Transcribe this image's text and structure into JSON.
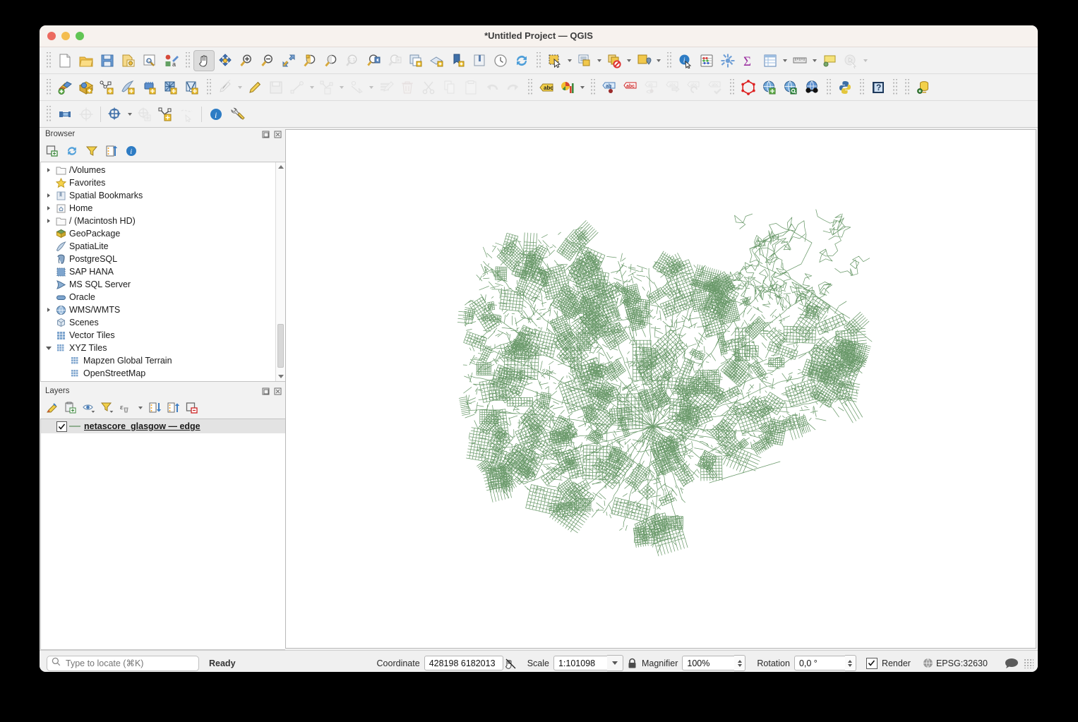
{
  "window": {
    "title": "*Untitled Project — QGIS",
    "traffic_lights": [
      "close",
      "minimize",
      "zoom"
    ]
  },
  "toolbars": {
    "row1": [
      {
        "name": "new-project-icon",
        "label": "New Project"
      },
      {
        "name": "open-project-icon",
        "label": "Open Project"
      },
      {
        "name": "save-project-icon",
        "label": "Save Project"
      },
      {
        "name": "new-print-layout-icon",
        "label": "New Print Layout"
      },
      {
        "name": "style-manager-icon",
        "label": "Style Manager"
      },
      {
        "name": "show-layout-manager-icon",
        "label": "Layout Manager"
      },
      {
        "name": "pan-map-icon",
        "label": "Pan Map",
        "selected": true
      },
      {
        "name": "pan-to-selection-icon",
        "label": "Pan Map to Selection"
      },
      {
        "name": "zoom-in-icon",
        "label": "Zoom In"
      },
      {
        "name": "zoom-out-icon",
        "label": "Zoom Out"
      },
      {
        "name": "zoom-full-icon",
        "label": "Zoom Full"
      },
      {
        "name": "zoom-selection-icon",
        "label": "Zoom to Selection"
      },
      {
        "name": "zoom-layer-icon",
        "label": "Zoom to Layer"
      },
      {
        "name": "zoom-native-icon",
        "label": "Zoom to Native Resolution"
      },
      {
        "name": "zoom-last-icon",
        "label": "Zoom Last"
      },
      {
        "name": "zoom-next-icon",
        "label": "Zoom Next"
      },
      {
        "name": "new-map-view-icon",
        "label": "New Map View"
      },
      {
        "name": "new-3d-map-view-icon",
        "label": "New 3D Map View"
      },
      {
        "name": "new-print-layout2-icon",
        "label": "New Print Layout"
      },
      {
        "name": "new-report-icon",
        "label": "New Report"
      },
      {
        "name": "temporal-controller-icon",
        "label": "Temporal Controller"
      },
      {
        "name": "refresh-icon",
        "label": "Refresh"
      },
      {
        "name": "select-features-icon",
        "label": "Select Features"
      },
      {
        "name": "select-value-icon",
        "label": "Select Features by Value"
      },
      {
        "name": "deselect-features-icon",
        "label": "Deselect Features"
      },
      {
        "name": "select-location-icon",
        "label": "Select by Location"
      },
      {
        "name": "identify-features-icon",
        "label": "Identify Features"
      },
      {
        "name": "statistical-summary-icon",
        "label": "Statistical Summary"
      },
      {
        "name": "processing-toolbox-icon",
        "label": "Processing Toolbox"
      },
      {
        "name": "field-calculator-icon",
        "label": "Field Calculator"
      },
      {
        "name": "attribute-table-icon",
        "label": "Open Attribute Table"
      },
      {
        "name": "measure-line-icon",
        "label": "Measure Line"
      },
      {
        "name": "map-tips-icon",
        "label": "Show Map Tips"
      },
      {
        "name": "run-model-icon",
        "label": "Run Model"
      }
    ],
    "row2": [
      {
        "name": "add-vector-layer-icon",
        "label": "Add Vector Layer"
      },
      {
        "name": "add-raster-layer-icon",
        "label": "Add Raster Layer"
      },
      {
        "name": "add-delimited-text-layer-icon",
        "label": "Add Delimited Text Layer"
      },
      {
        "name": "add-spatialite-layer-icon",
        "label": "Add SpatiaLite Layer"
      },
      {
        "name": "add-mesh-layer-icon",
        "label": "Add Mesh Layer"
      },
      {
        "name": "add-wms-layer-icon",
        "label": "Add WMS/WMTS Layer"
      },
      {
        "name": "add-vector-tile-layer-icon",
        "label": "Add Vector Tile Layer"
      },
      {
        "name": "current-edits-icon",
        "label": "Current Edits"
      },
      {
        "name": "toggle-editing-icon",
        "label": "Toggle Editing"
      },
      {
        "name": "save-layer-edits-icon",
        "label": "Save Layer Edits"
      },
      {
        "name": "add-line-feature-icon",
        "label": "Add Line Feature"
      },
      {
        "name": "vertex-tool-icon",
        "label": "Vertex Tool"
      },
      {
        "name": "modify-attributes-icon",
        "label": "Modify Attributes of Features"
      },
      {
        "name": "multi-edit-icon",
        "label": "Multi-Edit"
      },
      {
        "name": "delete-selected-icon",
        "label": "Delete Selected"
      },
      {
        "name": "cut-features-icon",
        "label": "Cut Features"
      },
      {
        "name": "copy-features-icon",
        "label": "Copy Features"
      },
      {
        "name": "paste-features-icon",
        "label": "Paste Features"
      },
      {
        "name": "undo-icon",
        "label": "Undo"
      },
      {
        "name": "redo-icon",
        "label": "Redo"
      },
      {
        "name": "label-icon",
        "label": "Layer Labeling Options"
      },
      {
        "name": "diagram-icon",
        "label": "Layer Diagram Options"
      },
      {
        "name": "highlight-pinned-labels-icon",
        "label": "Highlight Pinned Labels"
      },
      {
        "name": "pin-labels-icon",
        "label": "Pin/Unpin Labels"
      },
      {
        "name": "show-hide-labels-icon",
        "label": "Show/Hide Labels"
      },
      {
        "name": "move-label-icon",
        "label": "Move Label"
      },
      {
        "name": "rotate-label-icon",
        "label": "Rotate Label"
      },
      {
        "name": "change-label-icon",
        "label": "Change Label"
      },
      {
        "name": "georeferencer-icon",
        "label": "Georeferencer"
      },
      {
        "name": "metasearch-add-icon",
        "label": "MetaSearch"
      },
      {
        "name": "metasearch-find-icon",
        "label": "MetaSearch Catalogue"
      },
      {
        "name": "quickosm-icon",
        "label": "QuickOSM"
      },
      {
        "name": "python-console-icon",
        "label": "Python Console"
      },
      {
        "name": "help-icon",
        "label": "Help"
      },
      {
        "name": "db-manager-icon",
        "label": "DB Manager"
      }
    ],
    "row3": [
      {
        "name": "snapping-toolbar-icon",
        "label": "Snapping Options"
      },
      {
        "name": "enable-snapping-icon",
        "label": "Enable Snapping"
      },
      {
        "name": "snap-to-grid-icon",
        "label": "Snapping on Intersection"
      },
      {
        "name": "snap-add-icon",
        "label": "Add Snapping Mode"
      },
      {
        "name": "topological-editing-icon",
        "label": "Topological Editing"
      },
      {
        "name": "avoid-overlap-icon",
        "label": "Avoid Overlap"
      },
      {
        "name": "snapping-info-icon",
        "label": "Snapping Info"
      },
      {
        "name": "snapping-settings-icon",
        "label": "Snapping Settings"
      }
    ]
  },
  "browser": {
    "title": "Browser",
    "panel_buttons": [
      "float-panel-icon",
      "close-panel-icon"
    ],
    "toolbar": [
      {
        "name": "add-layer-icon",
        "label": "Add Selected Layers"
      },
      {
        "name": "refresh-icon",
        "label": "Refresh"
      },
      {
        "name": "filter-browser-icon",
        "label": "Filter Browser"
      },
      {
        "name": "collapse-all-icon",
        "label": "Collapse All"
      },
      {
        "name": "browser-properties-icon",
        "label": "Properties"
      }
    ],
    "items": [
      {
        "label": "/Volumes",
        "icon": "folder-icon",
        "expandable": true,
        "expanded": false,
        "indent": 0
      },
      {
        "label": "Favorites",
        "icon": "star-icon",
        "expandable": false,
        "indent": 0
      },
      {
        "label": "Spatial Bookmarks",
        "icon": "bookmark-icon",
        "expandable": true,
        "expanded": false,
        "indent": 0
      },
      {
        "label": "Home",
        "icon": "home-icon",
        "expandable": true,
        "expanded": false,
        "indent": 0
      },
      {
        "label": "/ (Macintosh HD)",
        "icon": "folder-icon",
        "expandable": true,
        "expanded": false,
        "indent": 0
      },
      {
        "label": "GeoPackage",
        "icon": "geopackage-icon",
        "expandable": false,
        "indent": 0
      },
      {
        "label": "SpatiaLite",
        "icon": "spatialite-icon",
        "expandable": false,
        "indent": 0
      },
      {
        "label": "PostgreSQL",
        "icon": "postgresql-icon",
        "expandable": false,
        "indent": 0
      },
      {
        "label": "SAP HANA",
        "icon": "saphana-icon",
        "expandable": false,
        "indent": 0
      },
      {
        "label": "MS SQL Server",
        "icon": "mssql-icon",
        "expandable": false,
        "indent": 0
      },
      {
        "label": "Oracle",
        "icon": "oracle-icon",
        "expandable": false,
        "indent": 0
      },
      {
        "label": "WMS/WMTS",
        "icon": "wms-icon",
        "expandable": true,
        "expanded": false,
        "indent": 0
      },
      {
        "label": "Scenes",
        "icon": "scenes-icon",
        "expandable": false,
        "indent": 0
      },
      {
        "label": "Vector Tiles",
        "icon": "vector-tiles-icon",
        "expandable": false,
        "indent": 0
      },
      {
        "label": "XYZ Tiles",
        "icon": "xyz-tiles-icon",
        "expandable": true,
        "expanded": true,
        "indent": 0
      },
      {
        "label": "Mapzen Global Terrain",
        "icon": "xyz-tiles-icon",
        "expandable": false,
        "indent": 1
      },
      {
        "label": "OpenStreetMap",
        "icon": "xyz-tiles-icon",
        "expandable": false,
        "indent": 1
      }
    ]
  },
  "layers": {
    "title": "Layers",
    "panel_buttons": [
      "float-panel-icon",
      "close-panel-icon"
    ],
    "toolbar": [
      {
        "name": "open-layer-styling-icon",
        "label": "Open the Layer Styling panel"
      },
      {
        "name": "add-group-icon",
        "label": "Add Group"
      },
      {
        "name": "manage-visibility-icon",
        "label": "Manage Map Themes"
      },
      {
        "name": "filter-legend-icon",
        "label": "Filter Legend"
      },
      {
        "name": "filter-expression-icon",
        "label": "Filter Legend by Expression"
      },
      {
        "name": "expand-all-icon",
        "label": "Expand All"
      },
      {
        "name": "collapse-all-icon",
        "label": "Collapse All"
      },
      {
        "name": "remove-layer-icon",
        "label": "Remove Layer/Group"
      }
    ],
    "items": [
      {
        "name": "netascore_glasgow — edge",
        "checked": true,
        "symbol_color": "#8fae8f",
        "selected": true
      }
    ]
  },
  "map": {
    "layer_color": "#6b9a6b",
    "background": "#ffffff"
  },
  "statusbar": {
    "locator_placeholder": "Type to locate (⌘K)",
    "locator_value": "",
    "status_message": "Ready",
    "coordinate_label": "Coordinate",
    "coordinate_value": "428198  6182013",
    "scale_label": "Scale",
    "scale_value": "1:101098",
    "magnifier_label": "Magnifier",
    "magnifier_value": "100%",
    "rotation_label": "Rotation",
    "rotation_value": "0,0 °",
    "render_label": "Render",
    "render_checked": true,
    "crs_value": "EPSG:32630",
    "lock_icon": "lock-icon",
    "messages_icon": "messages-icon",
    "crs_icon": "globe-icon",
    "toggle_extents_icon": "toggle-extents-icon"
  }
}
